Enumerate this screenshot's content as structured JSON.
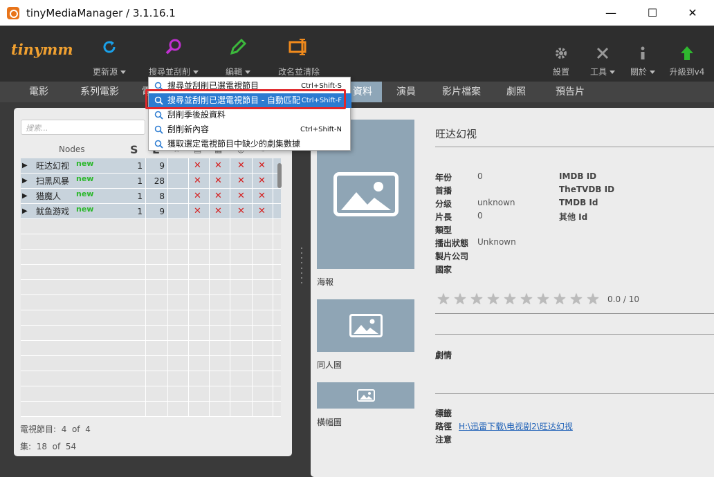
{
  "window": {
    "title": "tinyMediaManager / 3.1.16.1",
    "min": "—",
    "max": "☐",
    "close": "✕"
  },
  "logo": "tinymm",
  "toolbar": {
    "update": "更新源",
    "search": "搜尋並刮削",
    "edit": "編輯",
    "rename": "改名並清除",
    "settings": "設置",
    "tools": "工具",
    "about": "關於",
    "upgrade": "升級到v4"
  },
  "tabs": [
    "電影",
    "系列電影",
    "電視節目",
    "資料",
    "演員",
    "影片檔案",
    "劇照",
    "預告片"
  ],
  "left": {
    "search_placeholder": "搜索...",
    "headers": {
      "nodes": "Nodes",
      "s": "S",
      "e": "E"
    },
    "rows": [
      {
        "name": "旺达幻视",
        "badge": "new",
        "s": "1",
        "e": "9"
      },
      {
        "name": "扫黑风暴",
        "badge": "new",
        "s": "1",
        "e": "28"
      },
      {
        "name": "猎魔人",
        "badge": "new",
        "s": "1",
        "e": "8"
      },
      {
        "name": "鱿鱼游戏",
        "badge": "new",
        "s": "1",
        "e": "9"
      }
    ],
    "mark": "✕",
    "footer1": {
      "label": "電視節目:",
      "a": "4",
      "of": "of",
      "b": "4"
    },
    "footer2": {
      "label": "集:",
      "a": "18",
      "of": "of",
      "b": "54"
    }
  },
  "detail": {
    "title": "旺达幻视",
    "poster_label": "海報",
    "fanart_label": "同人圖",
    "banner_label": "橫幅圖",
    "fields": [
      {
        "k": "年份",
        "v": "0"
      },
      {
        "k": "首播",
        "v": ""
      },
      {
        "k": "分级",
        "v": "unknown"
      },
      {
        "k": "片長",
        "v": "0"
      },
      {
        "k": "類型",
        "v": ""
      },
      {
        "k": "播出狀態",
        "v": "Unknown"
      },
      {
        "k": "製片公司",
        "v": ""
      },
      {
        "k": "國家",
        "v": ""
      }
    ],
    "ids": [
      "IMDB ID",
      "TheTVDB ID",
      "TMDB Id",
      "其他 Id"
    ],
    "rating": "0.0 / 10",
    "rating_value": 0,
    "plot_label": "劇情",
    "tags_label": "標籤",
    "path_label": "路徑",
    "path_value": "H:\\迅雷下载\\电视剧2\\旺达幻视",
    "note_label": "注意"
  },
  "menu": {
    "items": [
      {
        "label": "搜尋並刮削已選電視節目",
        "shortcut": "Ctrl+Shift-S"
      },
      {
        "label": "搜尋並刮削已選電視節目 - 自動匹配",
        "shortcut": "Ctrl+Shift-F"
      },
      {
        "label": "刮削季後設資料",
        "shortcut": ""
      },
      {
        "label": "刮削新內容",
        "shortcut": "Ctrl+Shift-N"
      },
      {
        "label": "獲取選定電視節目中缺少的劇集數據",
        "shortcut": ""
      }
    ]
  },
  "colors": {
    "accent": "#2b7bd1",
    "highlight_box": "#e0282c",
    "tab_active": "#8ea6b8"
  }
}
